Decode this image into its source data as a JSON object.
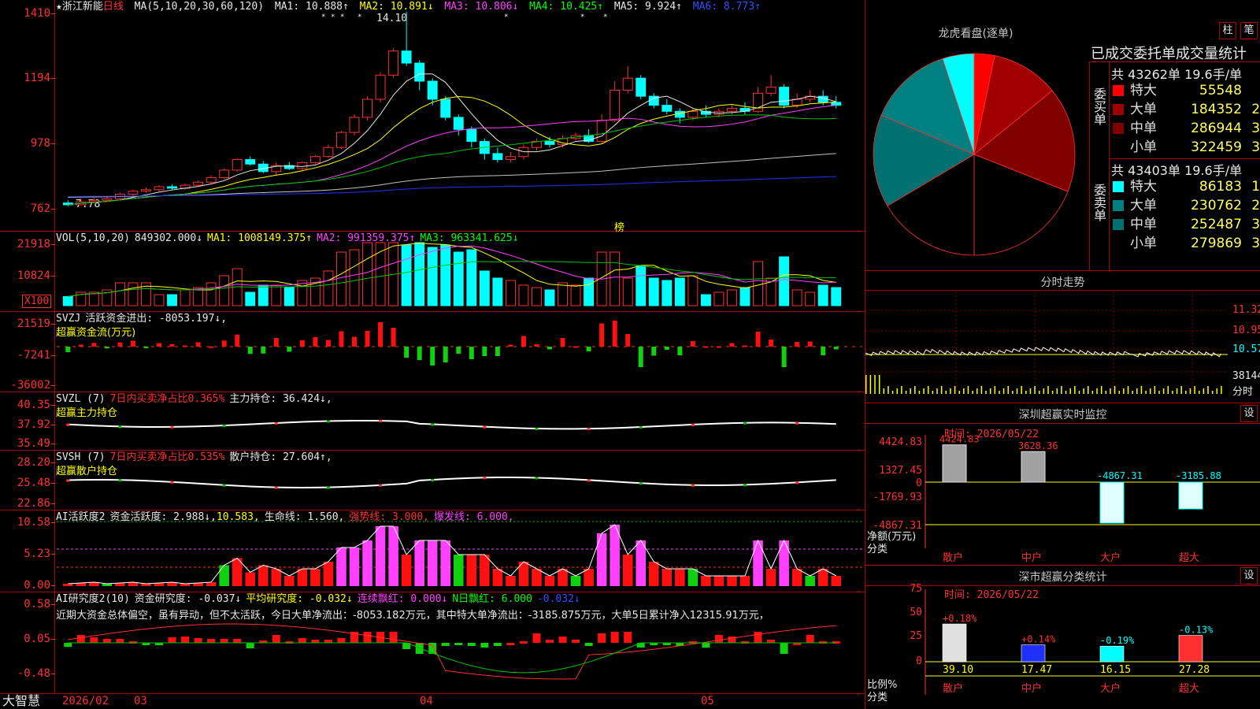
{
  "stock": {
    "name": "★浙江新能",
    "period": "日线",
    "ma_header": "MA(5,10,20,30,60,120)",
    "ma1": "MA1: 10.888↑",
    "ma2": "MA2: 10.891↓",
    "ma3": "MA3: 10.806↓",
    "ma4": "MA4: 10.425↑",
    "ma5": "MA5: 9.924↑",
    "ma6": "MA6: 8.773↑",
    "high_label": "14.10",
    "low_label": "7.78",
    "bang": "榜",
    "y_ticks": [
      "1410",
      "1194",
      "978",
      "762"
    ]
  },
  "vol": {
    "header": "VOL(5,10,20)",
    "v": "849302.000↓",
    "ma1": "MA1: 1008149.375↑",
    "ma2": "MA2: 991359.375↑",
    "ma3": "MA3: 963341.625↓",
    "y_ticks": [
      "21918",
      "10824"
    ],
    "unit": "X100"
  },
  "svzj": {
    "header": "SVZJ",
    "line1": "活跃资金进出: -8053.197↓,",
    "line2": "超赢资金流(万元)",
    "y_ticks": [
      "21519",
      "-7241",
      "-36002"
    ]
  },
  "svzl": {
    "header": "SVZL (7)",
    "pct": "7日内买卖净占比0.365%",
    "hold": "主力持仓: 36.424↓,",
    "line2": "超赢主力持仓",
    "y_ticks": [
      "40.35",
      "37.92",
      "35.49"
    ]
  },
  "svsh": {
    "header": "SVSH (7)",
    "pct": "7日内买卖净占比0.535%",
    "hold": "散户持仓: 27.604↑,",
    "line2": "超赢散户持仓",
    "y_ticks": [
      "28.20",
      "25.48",
      "22.86"
    ]
  },
  "ai1": {
    "header": "AI活跃度2",
    "a": "资金活跃度: 2.988↓,",
    "b": "10.583,",
    "c": "生命线: 1.560,",
    "d": "强势线: 3.000,",
    "e": "爆发线: 6.000,",
    "y_ticks": [
      "10.58",
      "5.23",
      "0.00"
    ]
  },
  "ai2": {
    "header": "AI研究度2(10)",
    "a": "资金研究度: -0.037↓",
    "b": "平均研究度: -0.032↓",
    "c": "连续飘红: 0.000↓",
    "d": "N日飘红: 6.000",
    "e": "-0.032↓",
    "text": "近期大资金总体偏空，虽有异动，但不太活跃，今日大单净流出：-8053.182万元，其中特大单净流出：-3185.875万元，大单5日累计净入12315.91万元，",
    "y_ticks": [
      "0.58",
      "0.05",
      "-0.48"
    ]
  },
  "bottom": {
    "logo": "大智慧",
    "dates": [
      "2026/02",
      "03",
      "04",
      "05"
    ]
  },
  "lhb": {
    "title": "龙虎看盘(逐单)",
    "btn1": "柱",
    "btn2": "笔",
    "subtitle": "已成交委托单成交量统计",
    "buy_label": "委买单",
    "sell_label": "委卖单",
    "buy_total": "共 43262单 19.6手/单",
    "sell_total": "共 43403单 19.6手/单",
    "buy": [
      {
        "name": "特大",
        "value": "55548",
        "pct": "7%",
        "color": "#ff0000"
      },
      {
        "name": "大单",
        "value": "184352",
        "pct": "22%",
        "color": "#a00000"
      },
      {
        "name": "中单",
        "value": "286944",
        "pct": "34%",
        "color": "#800000"
      },
      {
        "name": "小单",
        "value": "322459",
        "pct": "38%",
        "color": "#000000"
      }
    ],
    "sell": [
      {
        "name": "特大",
        "value": "86183",
        "pct": "10%",
        "color": "#00ffff"
      },
      {
        "name": "大单",
        "value": "230762",
        "pct": "27%",
        "color": "#008080"
      },
      {
        "name": "中单",
        "value": "252487",
        "pct": "30%",
        "color": "#007070"
      },
      {
        "name": "小单",
        "value": "279869",
        "pct": "33%",
        "color": "#000000"
      }
    ]
  },
  "fenshi": {
    "title": "分时走势",
    "y_ticks": [
      "11.32",
      "10.95",
      "10.57"
    ],
    "vol": "38144",
    "label": "分时"
  },
  "sz_monitor": {
    "title": "深圳超赢实时监控",
    "btn": "设",
    "time": "时间: 2026/05/22",
    "y_ticks": [
      "4424.83",
      "1327.45",
      "0",
      "-1769.93",
      "-4867.31"
    ],
    "ylabel": "净额(万元)",
    "xlabel": "分类",
    "categories": [
      "散户",
      "中户",
      "大户",
      "超大"
    ],
    "values": [
      "4424.83",
      "3628.36",
      "-4867.31",
      "-3185.88"
    ]
  },
  "sz_class": {
    "title": "深市超赢分类统计",
    "btn": "设",
    "time": "时间: 2026/05/22",
    "y_ticks": [
      "75",
      "50",
      "25",
      "0"
    ],
    "ylabel": "比例%",
    "xlabel": "分类",
    "categories": [
      "散户",
      "中户",
      "大户",
      "超大"
    ],
    "values": [
      "39.10",
      "17.47",
      "16.15",
      "27.28"
    ],
    "changes": [
      "+0.18%",
      "+0.14%",
      "-0.19%",
      "-0.13%"
    ]
  },
  "chart_data": {
    "type": "candlestick",
    "candles_approx": [
      [
        776,
        770,
        785,
        765
      ],
      [
        770,
        780,
        790,
        768
      ],
      [
        780,
        785,
        792,
        775
      ],
      [
        785,
        790,
        798,
        782
      ],
      [
        790,
        805,
        810,
        786
      ],
      [
        805,
        815,
        820,
        800
      ],
      [
        815,
        820,
        828,
        810
      ],
      [
        820,
        830,
        835,
        815
      ],
      [
        830,
        825,
        838,
        820
      ],
      [
        825,
        835,
        840,
        820
      ],
      [
        835,
        845,
        850,
        830
      ],
      [
        845,
        860,
        868,
        840
      ],
      [
        860,
        885,
        890,
        855
      ],
      [
        885,
        920,
        925,
        880
      ],
      [
        920,
        905,
        930,
        900
      ],
      [
        905,
        880,
        915,
        875
      ],
      [
        880,
        900,
        910,
        870
      ],
      [
        900,
        890,
        912,
        885
      ],
      [
        890,
        910,
        915,
        880
      ],
      [
        910,
        930,
        935,
        905
      ],
      [
        930,
        960,
        970,
        925
      ],
      [
        960,
        1010,
        1015,
        955
      ],
      [
        1010,
        1060,
        1070,
        1000
      ],
      [
        1060,
        1120,
        1130,
        1050
      ],
      [
        1120,
        1200,
        1210,
        1110
      ],
      [
        1200,
        1280,
        1290,
        1190
      ],
      [
        1280,
        1240,
        1410,
        1230
      ],
      [
        1240,
        1180,
        1250,
        1150
      ],
      [
        1180,
        1120,
        1190,
        1100
      ],
      [
        1120,
        1060,
        1130,
        1050
      ],
      [
        1060,
        1020,
        1070,
        1000
      ],
      [
        1020,
        980,
        1030,
        960
      ],
      [
        980,
        940,
        990,
        920
      ],
      [
        940,
        920,
        960,
        910
      ],
      [
        920,
        930,
        945,
        910
      ],
      [
        930,
        960,
        970,
        920
      ],
      [
        960,
        980,
        990,
        950
      ],
      [
        980,
        970,
        995,
        960
      ],
      [
        970,
        990,
        1000,
        960
      ],
      [
        990,
        1000,
        1010,
        985
      ],
      [
        1000,
        980,
        1020,
        975
      ],
      [
        980,
        1050,
        1070,
        975
      ],
      [
        1050,
        1150,
        1180,
        1045
      ],
      [
        1150,
        1190,
        1230,
        1140
      ],
      [
        1190,
        1130,
        1200,
        1120
      ],
      [
        1130,
        1100,
        1140,
        1090
      ],
      [
        1100,
        1080,
        1120,
        1070
      ],
      [
        1080,
        1060,
        1090,
        1040
      ],
      [
        1060,
        1080,
        1090,
        1050
      ],
      [
        1080,
        1070,
        1100,
        1060
      ],
      [
        1070,
        1080,
        1090,
        1060
      ],
      [
        1080,
        1090,
        1100,
        1070
      ],
      [
        1090,
        1080,
        1110,
        1070
      ],
      [
        1080,
        1140,
        1160,
        1075
      ],
      [
        1140,
        1160,
        1200,
        1130
      ],
      [
        1160,
        1100,
        1170,
        1090
      ],
      [
        1100,
        1120,
        1140,
        1090
      ],
      [
        1120,
        1130,
        1150,
        1110
      ],
      [
        1130,
        1110,
        1150,
        1100
      ],
      [
        1110,
        1100,
        1130,
        1090
      ]
    ]
  }
}
